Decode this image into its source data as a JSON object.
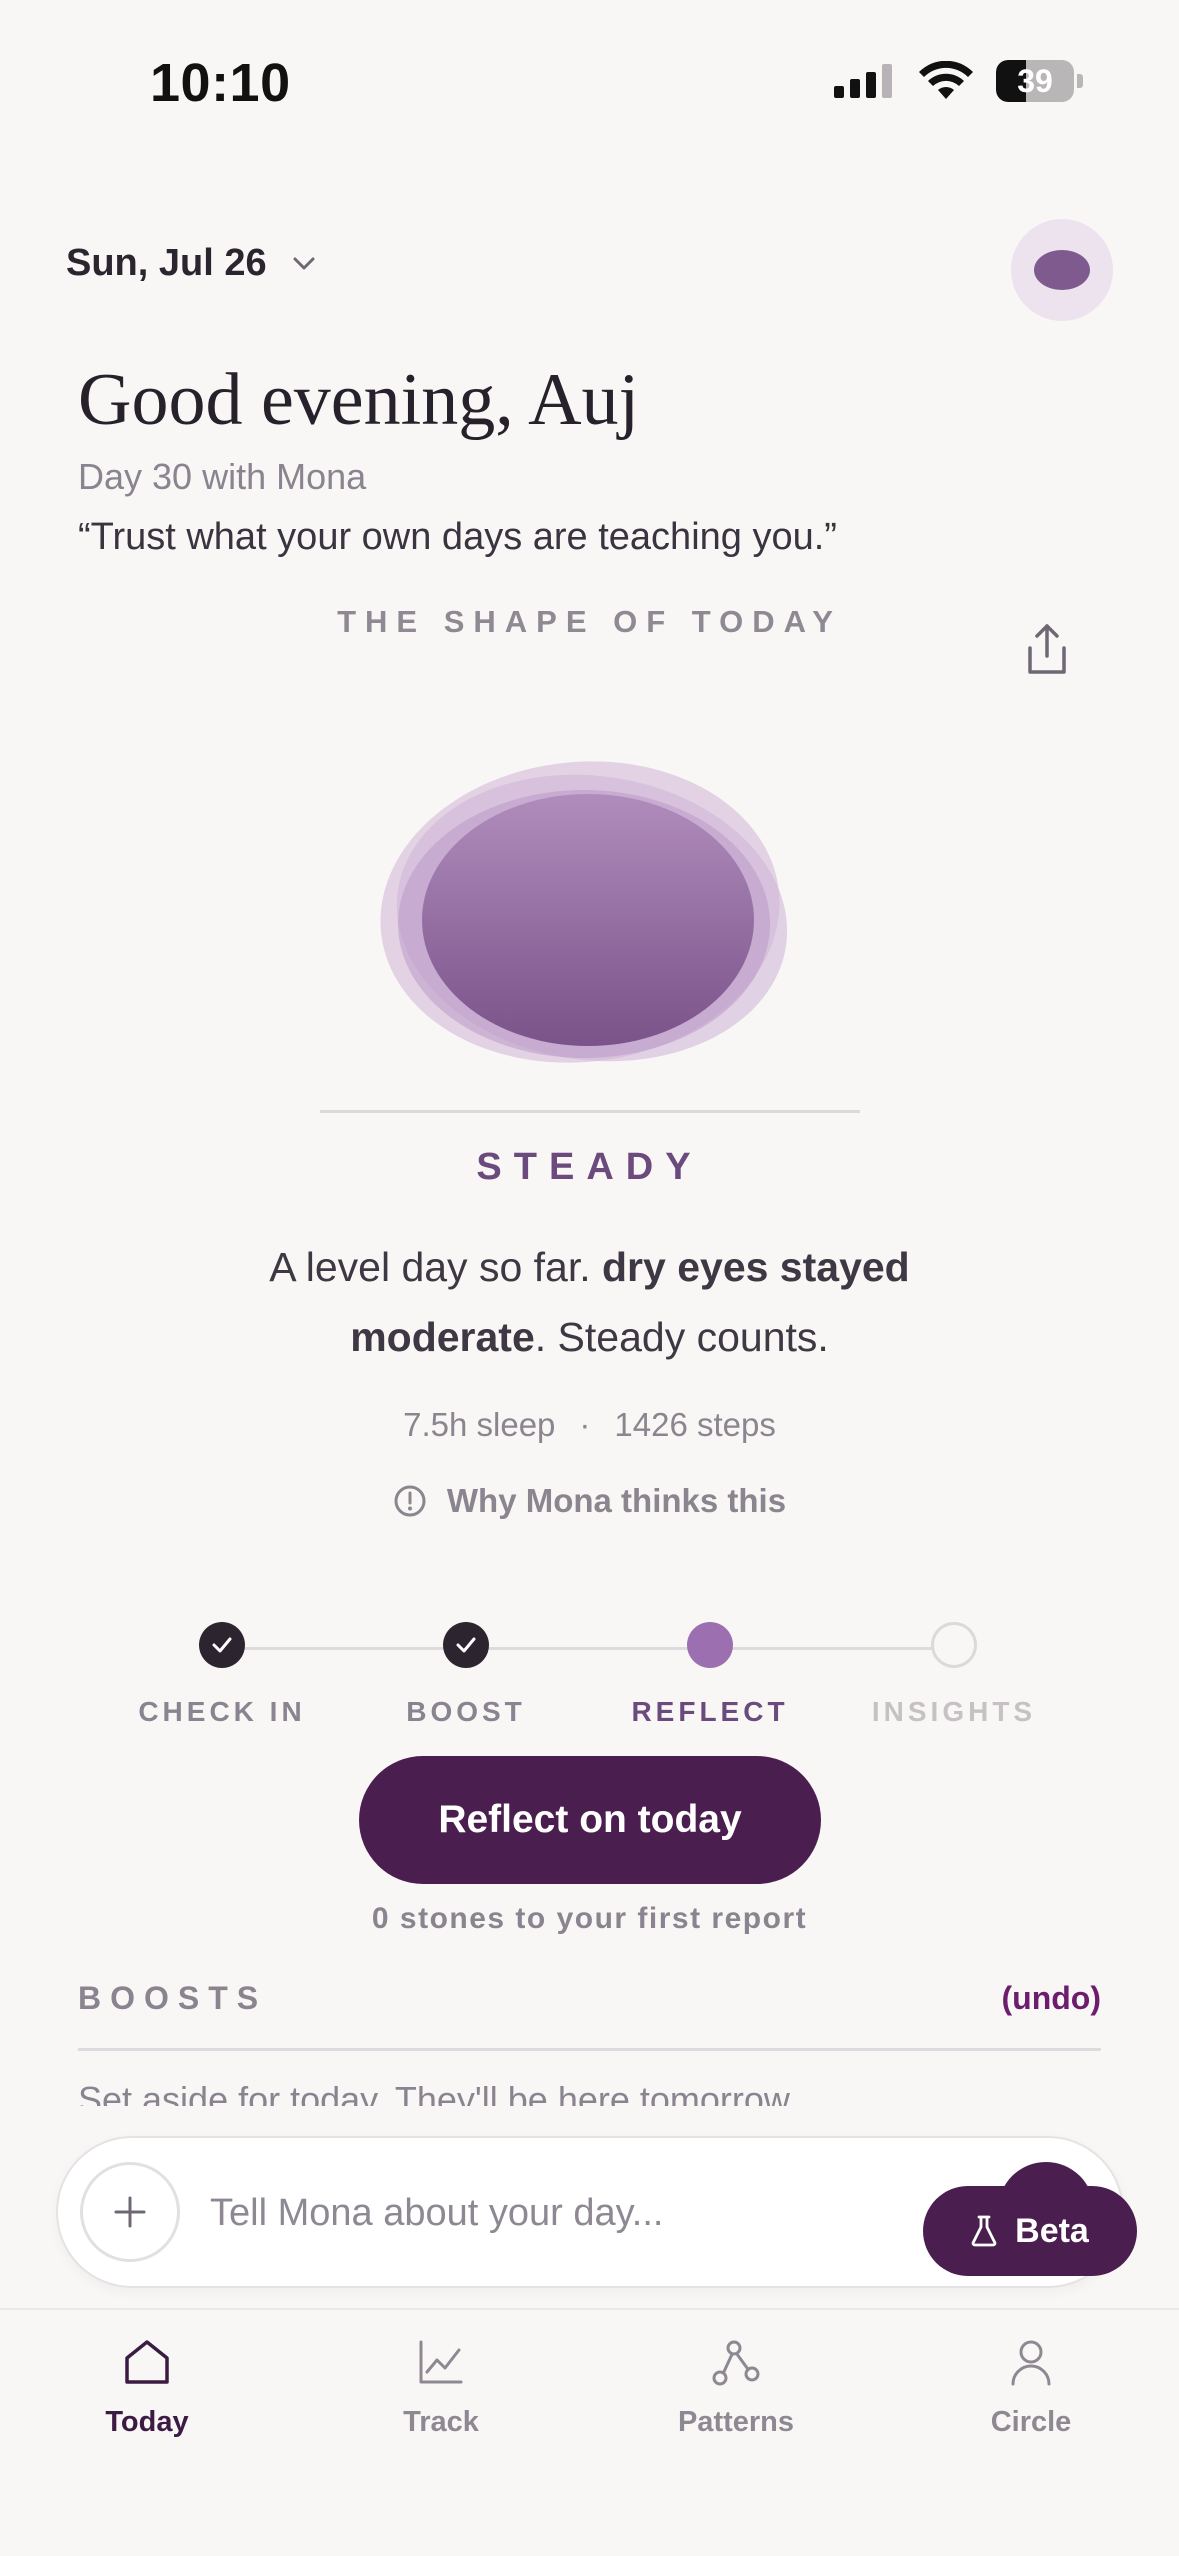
{
  "status_bar": {
    "time": "10:10",
    "battery": "39",
    "battery_level": 0.39
  },
  "header": {
    "date": "Sun, Jul 26"
  },
  "greeting": {
    "title": "Good evening, Auj",
    "day_count": "Day 30 with Mona",
    "quote": "“Trust what your own days are teaching you.”"
  },
  "shape_section": {
    "label": "THE SHAPE OF TODAY"
  },
  "mood": {
    "word": "STEADY",
    "summary_start": "A level day so far. ",
    "summary_bold": "dry eyes stayed moderate",
    "summary_end": ". Steady counts.",
    "sleep": "7.5h sleep",
    "separator": "·",
    "steps": "1426 steps",
    "why_label": "Why Mona thinks this"
  },
  "stepper": {
    "steps": [
      {
        "label": "CHECK IN",
        "state": "done"
      },
      {
        "label": "BOOST",
        "state": "done"
      },
      {
        "label": "REFLECT",
        "state": "active"
      },
      {
        "label": "INSIGHTS",
        "state": "pending"
      }
    ]
  },
  "cta": {
    "label": "Reflect on today",
    "subtext": "0 stones to your first report"
  },
  "boosts": {
    "label": "BOOSTS",
    "undo_label": "(undo)",
    "note": "Set aside for today. They'll be here tomorrow."
  },
  "chat": {
    "placeholder": "Tell Mona about your day..."
  },
  "beta": {
    "label": "Beta"
  },
  "tabs": [
    {
      "label": "Today",
      "icon": "home-icon",
      "active": true
    },
    {
      "label": "Track",
      "icon": "chart-line-icon",
      "active": false
    },
    {
      "label": "Patterns",
      "icon": "network-icon",
      "active": false
    },
    {
      "label": "Circle",
      "icon": "person-icon",
      "active": false
    }
  ],
  "colors": {
    "background": "#f9f7f5",
    "brand_dark": "#4a1f4f",
    "accent_purple": "#9c6fb0",
    "mood_text": "#6b4a7d",
    "undo": "#6c1d6e"
  }
}
